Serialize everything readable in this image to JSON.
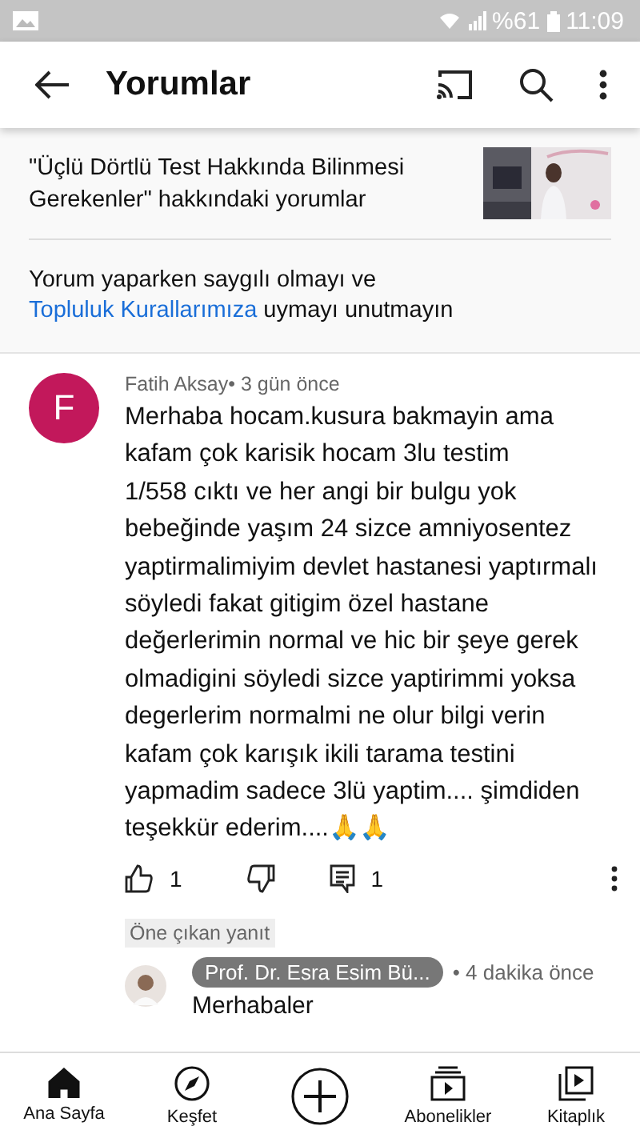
{
  "status_bar": {
    "battery": "%61",
    "time": "11:09"
  },
  "app_bar": {
    "title": "Yorumlar"
  },
  "video": {
    "title": "\"Üçlü Dörtlü Test Hakkında Bilinmesi Gerekenler\" hakkındaki yorumlar"
  },
  "guidelines": {
    "text_before": "Yorum yaparken saygılı olmayı ve",
    "link": "Topluluk Kurallarımıza",
    "text_after": "uymayı unutmayın"
  },
  "comment": {
    "avatar_letter": "F",
    "author": "Fatih Aksay",
    "time": "• 3 gün önce",
    "body": "Merhaba hocam.kusura bakmayin ama\nkafam çok karisik hocam 3lu testim\n1/558 cıktı ve her angi bir bulgu yok\nbebeğinde yaşım 24 sizce amniyosentez\nyaptirmalimiyim devlet hastanesi yaptırmalı\nsöyledi fakat gitigim özel hastane\ndeğerlerimin normal ve hic bir şeye gerek\nolmadigini söyledi sizce yaptirimmi yoksa\ndegerlerim normalmi ne olur bilgi verin\nkafam çok karışık ikili tarama testini\nyapmadim sadece 3lü yaptim.... şimdiden\nteşekkür ederim....🙏🙏",
    "likes": "1",
    "replies": "1"
  },
  "featured_reply": {
    "label": "Öne çıkan yanıt",
    "author": "Prof. Dr. Esra Esim Bü...",
    "time": "• 4 dakika önce",
    "body": "Merhabaler"
  },
  "bottom_nav": [
    {
      "kind": "home",
      "label": "Ana Sayfa",
      "selected": true
    },
    {
      "kind": "explore",
      "label": "Keşfet",
      "selected": false
    },
    {
      "kind": "create",
      "selected": false
    },
    {
      "kind": "subscriptions",
      "label": "Abonelikler",
      "selected": false
    },
    {
      "kind": "library",
      "label": "Kitaplık",
      "selected": false
    }
  ]
}
